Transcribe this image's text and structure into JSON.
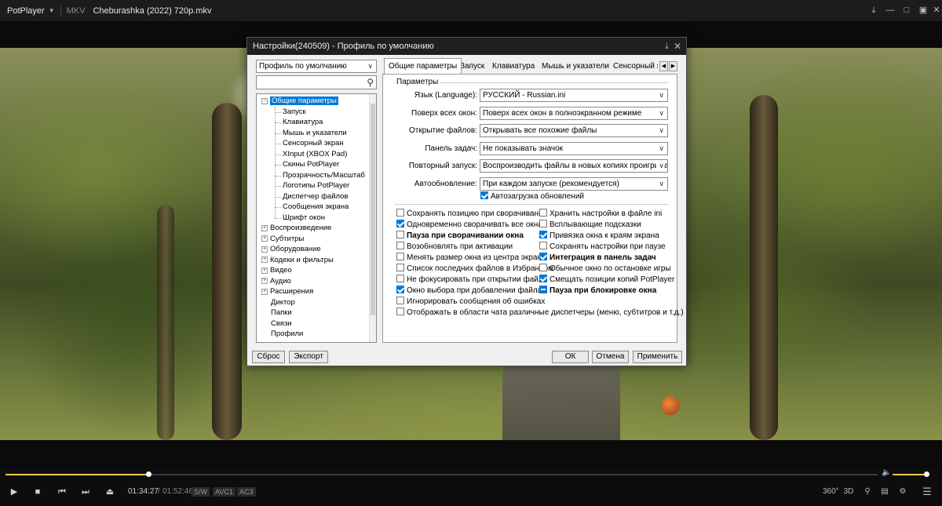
{
  "titlebar": {
    "app_name": "PotPlayer",
    "format": "MKV",
    "file_name": "Cheburashka (2022) 720p.mkv"
  },
  "playback": {
    "position_fraction": 0.164,
    "current_time": "01:34:27",
    "separator": "/",
    "total_time": "01:52:46",
    "tags": [
      "S/W",
      "AVC1",
      "AC3"
    ],
    "volume_fraction": 0.95
  },
  "right_controls": [
    "360°",
    "3D"
  ],
  "dialog": {
    "title": "Настройки(240509) - Профиль по умолчанию",
    "profile_select": "Профиль по умолчанию",
    "tree": {
      "root": "Общие параметры",
      "children": [
        "Запуск",
        "Клавиатура",
        "Мышь и указатели",
        "Сенсорный экран",
        "XInput (XBOX Pad)",
        "Скины PotPlayer",
        "Прозрачность/Масштаб",
        "Логотипы PotPlayer",
        "Диспетчер файлов",
        "Сообщения экрана",
        "Шрифт окон"
      ],
      "groups": [
        "Воспроизведение",
        "Субтитры",
        "Оборудование",
        "Кодеки и фильтры",
        "Видео",
        "Аудио",
        "Расширения"
      ],
      "tail": [
        "Диктор",
        "Папки",
        "Связи",
        "Профили"
      ]
    },
    "tabs": [
      "Общие параметры",
      "Запуск",
      "Клавиатура",
      "Мышь и указатели",
      "Сенсорный э"
    ],
    "group_title": "Параметры",
    "rows": [
      {
        "label": "Язык (Language):",
        "value": "РУССКИЙ - Russian.ini"
      },
      {
        "label": "Поверх всех окон:",
        "value": "Поверх всех окон в полноэкранном режиме"
      },
      {
        "label": "Открытие файлов:",
        "value": "Открывать все похожие файлы"
      },
      {
        "label": "Панель задач:",
        "value": "Не показывать значок"
      },
      {
        "label": "Повторный запуск:",
        "value": "Воспроизводить файлы в новых копиях проигрыват"
      },
      {
        "label": "Автообновление:",
        "value": "При каждом запуске (рекомендуется)"
      }
    ],
    "autoupdate_check": "Автозагрузка обновлений",
    "left_checks": [
      {
        "label": "Сохранять позицию при сворачивании",
        "state": "off",
        "bold": false
      },
      {
        "label": "Одновременно сворачивать все окна",
        "state": "on",
        "bold": false
      },
      {
        "label": "Пауза при сворачивании окна",
        "state": "off",
        "bold": true
      },
      {
        "label": "Возобновлять при активации",
        "state": "off",
        "bold": false
      },
      {
        "label": "Менять размер окна из центра экрана",
        "state": "off",
        "bold": false
      },
      {
        "label": "Список последних файлов в Избранном",
        "state": "off",
        "bold": false
      },
      {
        "label": "Не фокусировать при открытии файла",
        "state": "off",
        "bold": false
      },
      {
        "label": "Окно выбора при добавлении файла",
        "state": "on",
        "bold": false
      },
      {
        "label": "Игнорировать сообщения об ошибках",
        "state": "off",
        "bold": false
      }
    ],
    "right_checks": [
      {
        "label": "Хранить настройки в файле ini",
        "state": "off",
        "bold": false
      },
      {
        "label": "Всплывающие подсказки",
        "state": "off",
        "bold": false
      },
      {
        "label": "Привязка окна к краям экрана",
        "state": "on",
        "bold": false
      },
      {
        "label": "Сохранять настройки при паузе",
        "state": "off",
        "bold": false
      },
      {
        "label": "Интеграция в панель задач",
        "state": "on",
        "bold": true
      },
      {
        "label": "Обычное окно по остановке игры",
        "state": "off",
        "bold": false
      },
      {
        "label": "Смещать позиции копий PotPlayer",
        "state": "on",
        "bold": false
      },
      {
        "label": "Пауза при блокировке окна",
        "state": "ind",
        "bold": true
      }
    ],
    "wide_check": "Отображать в области чата различные диспетчеры (меню, субтитров и т.д.)",
    "buttons": {
      "reset": "Сброс",
      "export": "Экспорт",
      "ok": "ОК",
      "cancel": "Отмена",
      "apply": "Применить"
    }
  }
}
